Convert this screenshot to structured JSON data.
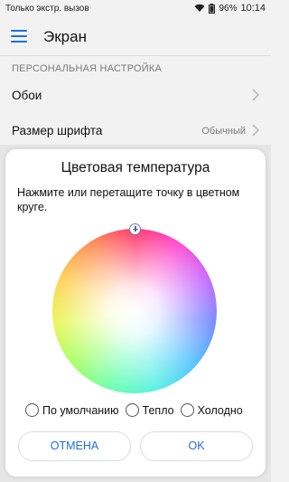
{
  "status_bar": {
    "carrier": "Только экстр. вызов",
    "battery": "96%",
    "time": "10:14"
  },
  "app_bar": {
    "title": "Экран"
  },
  "settings": {
    "section_header": "ПЕРСОНАЛЬНАЯ НАСТРОЙКА",
    "wallpaper_label": "Обои",
    "font_size_label": "Размер шрифта",
    "font_size_value": "Обычный"
  },
  "dialog": {
    "title": "Цветовая температура",
    "instruction": "Нажмите или перетащите точку в цветном круге.",
    "options": [
      {
        "label": "По умолчанию"
      },
      {
        "label": "Тепло"
      },
      {
        "label": "Холодно"
      }
    ],
    "cancel_label": "ОТМЕНА",
    "ok_label": "OK"
  },
  "colors": {
    "accent": "#1e6fd9",
    "background": "#f2f2f2",
    "dialog_bg": "#ffffff"
  },
  "icons": [
    "wifi-icon",
    "battery-icon",
    "menu-icon",
    "chevron-right-icon",
    "color-picker-handle-icon"
  ]
}
